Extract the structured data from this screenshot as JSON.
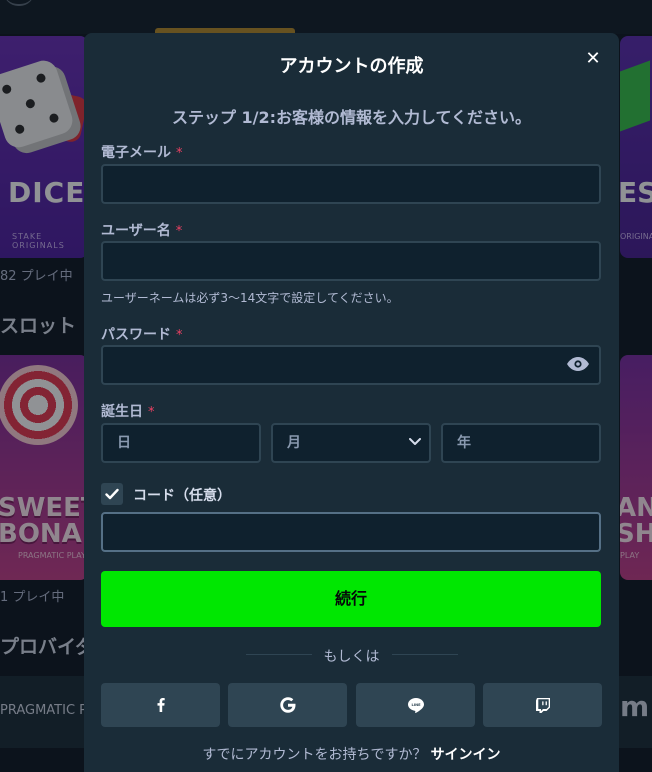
{
  "background": {
    "games": [
      {
        "title": "DICE",
        "provider": "STAKE ORIGINALS"
      },
      {
        "title": "ES",
        "provider": "ORIGINALS"
      },
      {
        "title": "SWEET\nBONANZ",
        "provider": "PRAGMATIC PLAY"
      },
      {
        "title": "AN\nSH",
        "provider": "PLAY"
      }
    ],
    "playing_count_1": "82 プレイ中",
    "section_slots": "スロット",
    "playing_count_2": "1 プレイ中",
    "section_providers": "プロバイダ",
    "provider_left": "PRAGMATIC PL",
    "provider_right": "m"
  },
  "modal": {
    "title": "アカウントの作成",
    "close_symbol": "✕",
    "step_text": "ステップ 1/2:お客様の情報を入力してください。",
    "fields": {
      "email": {
        "label": "電子メール",
        "required_mark": "*",
        "value": ""
      },
      "username": {
        "label": "ユーザー名",
        "required_mark": "*",
        "value": "",
        "hint": "ユーザーネームは必ず3～14文字で設定してください。"
      },
      "password": {
        "label": "パスワード",
        "required_mark": "*",
        "value": ""
      },
      "birthdate": {
        "label": "誕生日",
        "required_mark": "*",
        "day_placeholder": "日",
        "month_placeholder": "月",
        "year_placeholder": "年"
      },
      "code": {
        "label": "コード（任意）",
        "checked": true,
        "value": ""
      }
    },
    "continue_label": "続行",
    "or_text": "もしくは",
    "social_icons": [
      "facebook-icon",
      "google-icon",
      "line-icon",
      "twitch-icon"
    ],
    "signin_prompt": "すでにアカウントをお持ちですか？",
    "signin_link": "サインイン"
  },
  "colors": {
    "modal_bg": "#1a2c38",
    "input_bg": "#0f212e",
    "input_border": "#2f4553",
    "accent_green": "#00e701",
    "required_red": "#ed4163"
  }
}
